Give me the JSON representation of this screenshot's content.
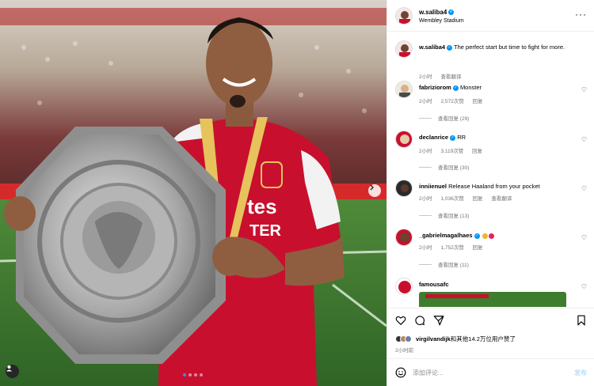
{
  "post": {
    "username": "w.saliba4",
    "location": "Wembley Stadium",
    "caption": "The perfect start but time to fight for more.",
    "caption_time": "2小时",
    "translate_label": "查看翻译"
  },
  "comments": [
    {
      "username": "fabriziorom",
      "text": "Monster",
      "time": "2小时",
      "likes": "2,572次赞",
      "reply": "回复",
      "view_replies": "查看回复 (29)"
    },
    {
      "username": "declanrice",
      "text": "RR",
      "time": "2小时",
      "likes": "3,119次赞",
      "reply": "回复",
      "view_replies": "查看回复 (30)"
    },
    {
      "username": "inniienuel",
      "text": "Release Haaland from your pocket",
      "time": "2小时",
      "likes": "1,036次赞",
      "reply": "回复",
      "translate": "查看翻译",
      "view_replies": "查看回复 (13)"
    },
    {
      "username": "_gabrielmagalhaes",
      "time": "2小时",
      "likes": "1,752次赞",
      "reply": "回复",
      "view_replies": "查看回复 (11)"
    },
    {
      "username": "famousafc"
    }
  ],
  "likes": {
    "user": "virgilvandijk",
    "rest": "和其他14.2万位用户赞了"
  },
  "post_time": "2小时前",
  "composer": {
    "placeholder": "添加评论...",
    "post_label": "发布"
  },
  "icons": {
    "more": "more-horizontal-icon",
    "verified": "verified-badge-icon",
    "like": "heart-icon",
    "comment": "comment-icon",
    "share": "send-icon",
    "save": "bookmark-icon",
    "emoji": "emoji-icon",
    "next": "chevron-right-icon",
    "tag": "user-tag-icon"
  },
  "colors": {
    "verified": "#0095f6",
    "muted": "#737373",
    "post_disabled": "#b2dffc",
    "carousel_active": "#3a8cf1",
    "arsenal_red": "#c8102e"
  },
  "carousel": {
    "slides": 4,
    "active": 1
  }
}
